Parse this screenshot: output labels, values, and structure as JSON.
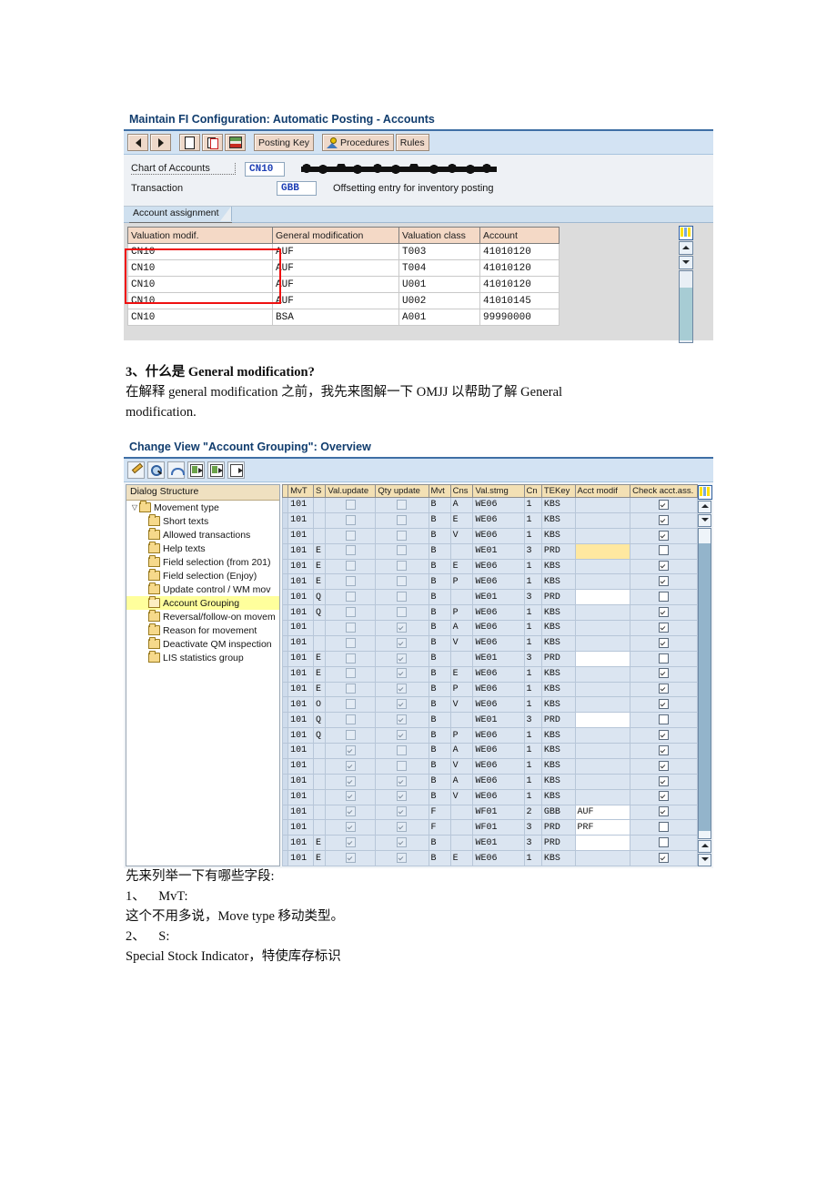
{
  "shot1": {
    "title": "Maintain FI Configuration: Automatic Posting - Accounts",
    "toolbar": {
      "back_icon": "arrow-left-icon",
      "forward_icon": "arrow-right-icon",
      "new_icon": "new-document-icon",
      "copy_icon": "copy-icon",
      "layout_icon": "grid-layout-icon",
      "posting_key": "Posting Key",
      "procedures_icon": "person-icon",
      "procedures": "Procedures",
      "rules": "Rules"
    },
    "fields": [
      {
        "label": "Chart of Accounts",
        "value": "CN10",
        "desc": "",
        "redacted": true
      },
      {
        "label": "Transaction",
        "value": "GBB",
        "desc": "Offsetting entry for inventory posting",
        "redacted": false
      }
    ],
    "tab": "Account assignment",
    "table": {
      "columns": [
        "Valuation modif.",
        "General modification",
        "Valuation class",
        "Account"
      ],
      "rows": [
        [
          "CN10",
          "AUF",
          "T003",
          "41010120"
        ],
        [
          "CN10",
          "AUF",
          "T004",
          "41010120"
        ],
        [
          "CN10",
          "AUF",
          "U001",
          "41010120"
        ],
        [
          "CN10",
          "AUF",
          "U002",
          "41010145"
        ],
        [
          "CN10",
          "BSA",
          "A001",
          "99990000"
        ]
      ]
    },
    "scroll": {
      "config_icon": "table-settings-icon",
      "up_icon": "scroll-up-icon",
      "down_icon": "scroll-down-icon"
    }
  },
  "text1": {
    "heading": "3、什么是 General modification?",
    "body": "在解释 general modification 之前，我先来图解一下 OMJJ 以帮助了解 General\nmodification."
  },
  "shot2": {
    "title": "Change View \"Account Grouping\": Overview",
    "toolbar": [
      {
        "name": "change-pencil-icon"
      },
      {
        "name": "display-magnifier-icon"
      },
      {
        "name": "undo-icon"
      },
      {
        "name": "copy-as-icon"
      },
      {
        "name": "new-entries-icon"
      },
      {
        "name": "delete-entry-icon"
      }
    ],
    "tree": {
      "header": "Dialog Structure",
      "root": "Movement type",
      "items": [
        "Short texts",
        "Allowed transactions",
        "Help texts",
        "Field selection (from 201)",
        "Field selection (Enjoy)",
        "Update control / WM mov",
        "Account Grouping",
        "Reversal/follow-on movem",
        "Reason for movement",
        "Deactivate QM inspection",
        "LIS statistics group"
      ],
      "selected": "Account Grouping"
    },
    "table": {
      "columns": [
        "MvT",
        "S",
        "Val.update",
        "Qty update",
        "Mvt",
        "Cns",
        "Val.stmg",
        "Cn",
        "TEKey",
        "Acct modif",
        "Check acct.ass."
      ],
      "rows": [
        {
          "mvt": "101",
          "s": "",
          "val_update": false,
          "qty_update": false,
          "m": "B",
          "cns": "A",
          "valstmg": "WE06",
          "cn": "1",
          "tekey": "KBS",
          "acct_modif": "",
          "acct_modif_style": "plain",
          "check": true
        },
        {
          "mvt": "101",
          "s": "",
          "val_update": false,
          "qty_update": false,
          "m": "B",
          "cns": "E",
          "valstmg": "WE06",
          "cn": "1",
          "tekey": "KBS",
          "acct_modif": "",
          "acct_modif_style": "plain",
          "check": true
        },
        {
          "mvt": "101",
          "s": "",
          "val_update": false,
          "qty_update": false,
          "m": "B",
          "cns": "V",
          "valstmg": "WE06",
          "cn": "1",
          "tekey": "KBS",
          "acct_modif": "",
          "acct_modif_style": "plain",
          "check": true
        },
        {
          "mvt": "101",
          "s": "E",
          "val_update": false,
          "qty_update": false,
          "m": "B",
          "cns": "",
          "valstmg": "WE01",
          "cn": "3",
          "tekey": "PRD",
          "acct_modif": "",
          "acct_modif_style": "yellow",
          "check": false
        },
        {
          "mvt": "101",
          "s": "E",
          "val_update": false,
          "qty_update": false,
          "m": "B",
          "cns": "E",
          "valstmg": "WE06",
          "cn": "1",
          "tekey": "KBS",
          "acct_modif": "",
          "acct_modif_style": "plain",
          "check": true
        },
        {
          "mvt": "101",
          "s": "E",
          "val_update": false,
          "qty_update": false,
          "m": "B",
          "cns": "P",
          "valstmg": "WE06",
          "cn": "1",
          "tekey": "KBS",
          "acct_modif": "",
          "acct_modif_style": "plain",
          "check": true
        },
        {
          "mvt": "101",
          "s": "Q",
          "val_update": false,
          "qty_update": false,
          "m": "B",
          "cns": "",
          "valstmg": "WE01",
          "cn": "3",
          "tekey": "PRD",
          "acct_modif": "",
          "acct_modif_style": "white",
          "check": false
        },
        {
          "mvt": "101",
          "s": "Q",
          "val_update": false,
          "qty_update": false,
          "m": "B",
          "cns": "P",
          "valstmg": "WE06",
          "cn": "1",
          "tekey": "KBS",
          "acct_modif": "",
          "acct_modif_style": "plain",
          "check": true
        },
        {
          "mvt": "101",
          "s": "",
          "val_update": false,
          "qty_update": true,
          "m": "B",
          "cns": "A",
          "valstmg": "WE06",
          "cn": "1",
          "tekey": "KBS",
          "acct_modif": "",
          "acct_modif_style": "plain",
          "check": true
        },
        {
          "mvt": "101",
          "s": "",
          "val_update": false,
          "qty_update": true,
          "m": "B",
          "cns": "V",
          "valstmg": "WE06",
          "cn": "1",
          "tekey": "KBS",
          "acct_modif": "",
          "acct_modif_style": "plain",
          "check": true
        },
        {
          "mvt": "101",
          "s": "E",
          "val_update": false,
          "qty_update": true,
          "m": "B",
          "cns": "",
          "valstmg": "WE01",
          "cn": "3",
          "tekey": "PRD",
          "acct_modif": "",
          "acct_modif_style": "white",
          "check": false
        },
        {
          "mvt": "101",
          "s": "E",
          "val_update": false,
          "qty_update": true,
          "m": "B",
          "cns": "E",
          "valstmg": "WE06",
          "cn": "1",
          "tekey": "KBS",
          "acct_modif": "",
          "acct_modif_style": "plain",
          "check": true
        },
        {
          "mvt": "101",
          "s": "E",
          "val_update": false,
          "qty_update": true,
          "m": "B",
          "cns": "P",
          "valstmg": "WE06",
          "cn": "1",
          "tekey": "KBS",
          "acct_modif": "",
          "acct_modif_style": "plain",
          "check": true
        },
        {
          "mvt": "101",
          "s": "O",
          "val_update": false,
          "qty_update": true,
          "m": "B",
          "cns": "V",
          "valstmg": "WE06",
          "cn": "1",
          "tekey": "KBS",
          "acct_modif": "",
          "acct_modif_style": "plain",
          "check": true
        },
        {
          "mvt": "101",
          "s": "Q",
          "val_update": false,
          "qty_update": true,
          "m": "B",
          "cns": "",
          "valstmg": "WE01",
          "cn": "3",
          "tekey": "PRD",
          "acct_modif": "",
          "acct_modif_style": "white",
          "check": false
        },
        {
          "mvt": "101",
          "s": "Q",
          "val_update": false,
          "qty_update": true,
          "m": "B",
          "cns": "P",
          "valstmg": "WE06",
          "cn": "1",
          "tekey": "KBS",
          "acct_modif": "",
          "acct_modif_style": "plain",
          "check": true
        },
        {
          "mvt": "101",
          "s": "",
          "val_update": true,
          "qty_update": false,
          "m": "B",
          "cns": "A",
          "valstmg": "WE06",
          "cn": "1",
          "tekey": "KBS",
          "acct_modif": "",
          "acct_modif_style": "plain",
          "check": true
        },
        {
          "mvt": "101",
          "s": "",
          "val_update": true,
          "qty_update": false,
          "m": "B",
          "cns": "V",
          "valstmg": "WE06",
          "cn": "1",
          "tekey": "KBS",
          "acct_modif": "",
          "acct_modif_style": "plain",
          "check": true
        },
        {
          "mvt": "101",
          "s": "",
          "val_update": true,
          "qty_update": true,
          "m": "B",
          "cns": "A",
          "valstmg": "WE06",
          "cn": "1",
          "tekey": "KBS",
          "acct_modif": "",
          "acct_modif_style": "plain",
          "check": true
        },
        {
          "mvt": "101",
          "s": "",
          "val_update": true,
          "qty_update": true,
          "m": "B",
          "cns": "V",
          "valstmg": "WE06",
          "cn": "1",
          "tekey": "KBS",
          "acct_modif": "",
          "acct_modif_style": "plain",
          "check": true
        },
        {
          "mvt": "101",
          "s": "",
          "val_update": true,
          "qty_update": true,
          "m": "F",
          "cns": "",
          "valstmg": "WF01",
          "cn": "2",
          "tekey": "GBB",
          "acct_modif": "AUF",
          "acct_modif_style": "white",
          "check": true
        },
        {
          "mvt": "101",
          "s": "",
          "val_update": true,
          "qty_update": true,
          "m": "F",
          "cns": "",
          "valstmg": "WF01",
          "cn": "3",
          "tekey": "PRD",
          "acct_modif": "PRF",
          "acct_modif_style": "white",
          "check": false
        },
        {
          "mvt": "101",
          "s": "E",
          "val_update": true,
          "qty_update": true,
          "m": "B",
          "cns": "",
          "valstmg": "WE01",
          "cn": "3",
          "tekey": "PRD",
          "acct_modif": "",
          "acct_modif_style": "white",
          "check": false
        },
        {
          "mvt": "101",
          "s": "E",
          "val_update": true,
          "qty_update": true,
          "m": "B",
          "cns": "E",
          "valstmg": "WE06",
          "cn": "1",
          "tekey": "KBS",
          "acct_modif": "",
          "acct_modif_style": "plain",
          "check": true
        }
      ]
    }
  },
  "text2": {
    "line1": "先来列举一下有哪些字段:",
    "line2": "1、    MvT:",
    "line3": "这个不用多说，Move type 移动类型。",
    "line4": "2、    S:",
    "line5": "Special Stock Indicator，特使库存标识"
  }
}
